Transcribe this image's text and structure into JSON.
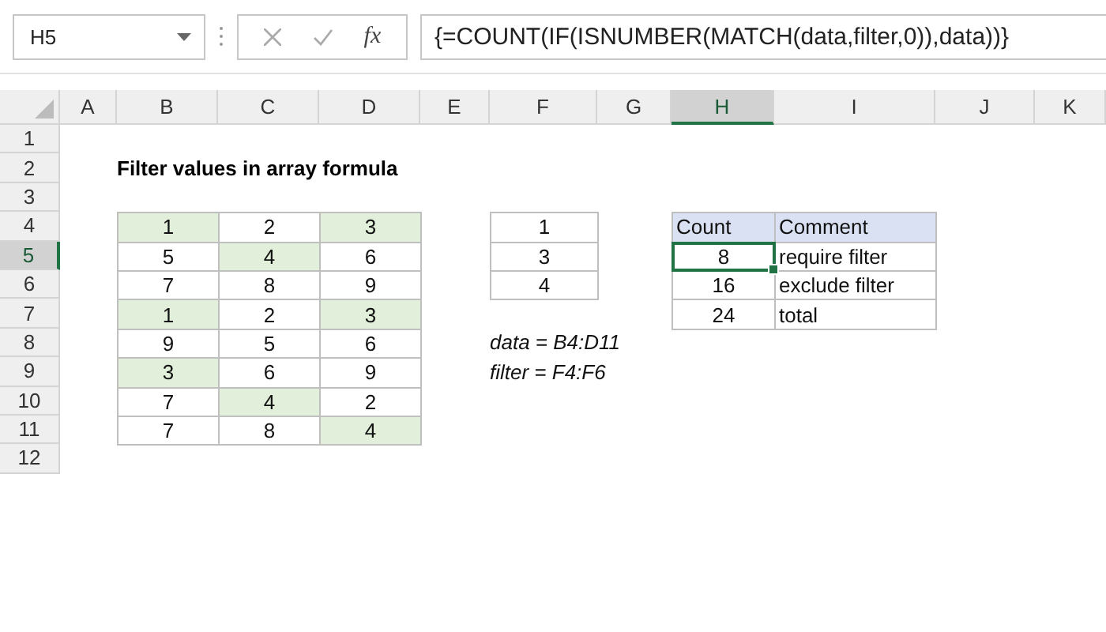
{
  "name_box": "H5",
  "function_label": "fx",
  "formula": "{=COUNT(IF(ISNUMBER(MATCH(data,filter,0)),data))}",
  "columns": [
    {
      "label": "A",
      "selected": false
    },
    {
      "label": "B",
      "selected": false
    },
    {
      "label": "C",
      "selected": false
    },
    {
      "label": "D",
      "selected": false
    },
    {
      "label": "E",
      "selected": false
    },
    {
      "label": "F",
      "selected": false
    },
    {
      "label": "G",
      "selected": false
    },
    {
      "label": "H",
      "selected": true
    },
    {
      "label": "I",
      "selected": false
    },
    {
      "label": "J",
      "selected": false
    },
    {
      "label": "K",
      "selected": false
    }
  ],
  "rows": [
    {
      "label": "1",
      "selected": false
    },
    {
      "label": "2",
      "selected": false
    },
    {
      "label": "3",
      "selected": false
    },
    {
      "label": "4",
      "selected": false
    },
    {
      "label": "5",
      "selected": true
    },
    {
      "label": "6",
      "selected": false
    },
    {
      "label": "7",
      "selected": false
    },
    {
      "label": "8",
      "selected": false
    },
    {
      "label": "9",
      "selected": false
    },
    {
      "label": "10",
      "selected": false
    },
    {
      "label": "11",
      "selected": false
    },
    {
      "label": "12",
      "selected": false
    }
  ],
  "title": "Filter values in array formula",
  "data": [
    [
      {
        "value": "1",
        "highlighted": true
      },
      {
        "value": "2",
        "highlighted": false
      },
      {
        "value": "3",
        "highlighted": true
      }
    ],
    [
      {
        "value": "5",
        "highlighted": false
      },
      {
        "value": "4",
        "highlighted": true
      },
      {
        "value": "6",
        "highlighted": false
      }
    ],
    [
      {
        "value": "7",
        "highlighted": false
      },
      {
        "value": "8",
        "highlighted": false
      },
      {
        "value": "9",
        "highlighted": false
      }
    ],
    [
      {
        "value": "1",
        "highlighted": true
      },
      {
        "value": "2",
        "highlighted": false
      },
      {
        "value": "3",
        "highlighted": true
      }
    ],
    [
      {
        "value": "9",
        "highlighted": false
      },
      {
        "value": "5",
        "highlighted": false
      },
      {
        "value": "6",
        "highlighted": false
      }
    ],
    [
      {
        "value": "3",
        "highlighted": true
      },
      {
        "value": "6",
        "highlighted": false
      },
      {
        "value": "9",
        "highlighted": false
      }
    ],
    [
      {
        "value": "7",
        "highlighted": false
      },
      {
        "value": "4",
        "highlighted": true
      },
      {
        "value": "2",
        "highlighted": false
      }
    ],
    [
      {
        "value": "7",
        "highlighted": false
      },
      {
        "value": "8",
        "highlighted": false
      },
      {
        "value": "4",
        "highlighted": true
      }
    ]
  ],
  "filter": [
    "1",
    "3",
    "4"
  ],
  "results": {
    "columns": [
      "Count",
      "Comment"
    ],
    "rows": [
      {
        "count": "8",
        "comment": "require filter",
        "selected": true
      },
      {
        "count": "16",
        "comment": "exclude filter",
        "selected": false
      },
      {
        "count": "24",
        "comment": "total",
        "selected": false
      }
    ]
  },
  "names": [
    "data = B4:D11",
    "filter = F4:F6"
  ]
}
